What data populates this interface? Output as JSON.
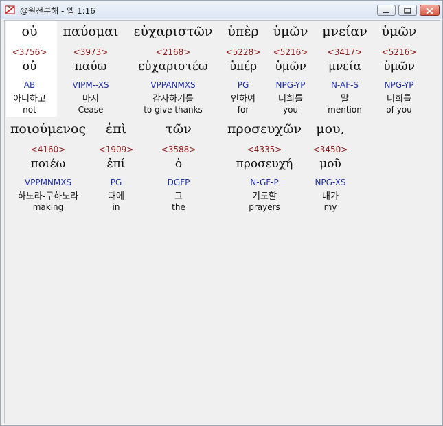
{
  "window": {
    "title": "@원전분해 - 엡 1:16",
    "icon": "bible-app-icon"
  },
  "rows": [
    [
      {
        "greek": "οὐ",
        "strong": "<3756>",
        "lemma": "οὐ",
        "parse": "AB",
        "korean": "아니하고",
        "english": "not"
      },
      {
        "greek": "παύομαι",
        "strong": "<3973>",
        "lemma": "παύω",
        "parse": "VIPM--XS",
        "korean": "마지",
        "english": "Cease"
      },
      {
        "greek": "εὐχαριστῶν",
        "strong": "<2168>",
        "lemma": "εὐχαριστέω",
        "parse": "VPPANMXS",
        "korean": "감사하기를",
        "english": "to give thanks"
      },
      {
        "greek": "ὑπὲρ",
        "strong": "<5228>",
        "lemma": "ὑπέρ",
        "parse": "PG",
        "korean": "인하여",
        "english": "for"
      },
      {
        "greek": "ὑμῶν",
        "strong": "<5216>",
        "lemma": "ὑμῶν",
        "parse": "NPG-YP",
        "korean": "너희를",
        "english": "you"
      },
      {
        "greek": "μνείαν",
        "strong": "<3417>",
        "lemma": "μνεία",
        "parse": "N-AF-S",
        "korean": "말",
        "english": "mention"
      },
      {
        "greek": "ὑμῶν",
        "strong": "<5216>",
        "lemma": "ὑμῶν",
        "parse": "NPG-YP",
        "korean": "너희를",
        "english": "of you"
      }
    ],
    [
      {
        "greek": "ποιούμενος",
        "strong": "<4160>",
        "lemma": "ποιέω",
        "parse": "VPPMNMXS",
        "korean": "하노라-구하노라",
        "english": "making"
      },
      {
        "greek": "ἐπὶ",
        "strong": "<1909>",
        "lemma": "ἐπί",
        "parse": "PG",
        "korean": "때에",
        "english": "in"
      },
      {
        "greek": "τῶν",
        "strong": "<3588>",
        "lemma": "ὁ",
        "parse": "DGFP",
        "korean": "그",
        "english": "the"
      },
      {
        "greek": "προσευχῶν",
        "strong": "<4335>",
        "lemma": "προσευχή",
        "parse": "N-GF-P",
        "korean": "기도할",
        "english": "prayers"
      },
      {
        "greek": "μου,",
        "strong": "<3450>",
        "lemma": "μοῦ",
        "parse": "NPG-XS",
        "korean": "내가",
        "english": "my"
      }
    ]
  ]
}
